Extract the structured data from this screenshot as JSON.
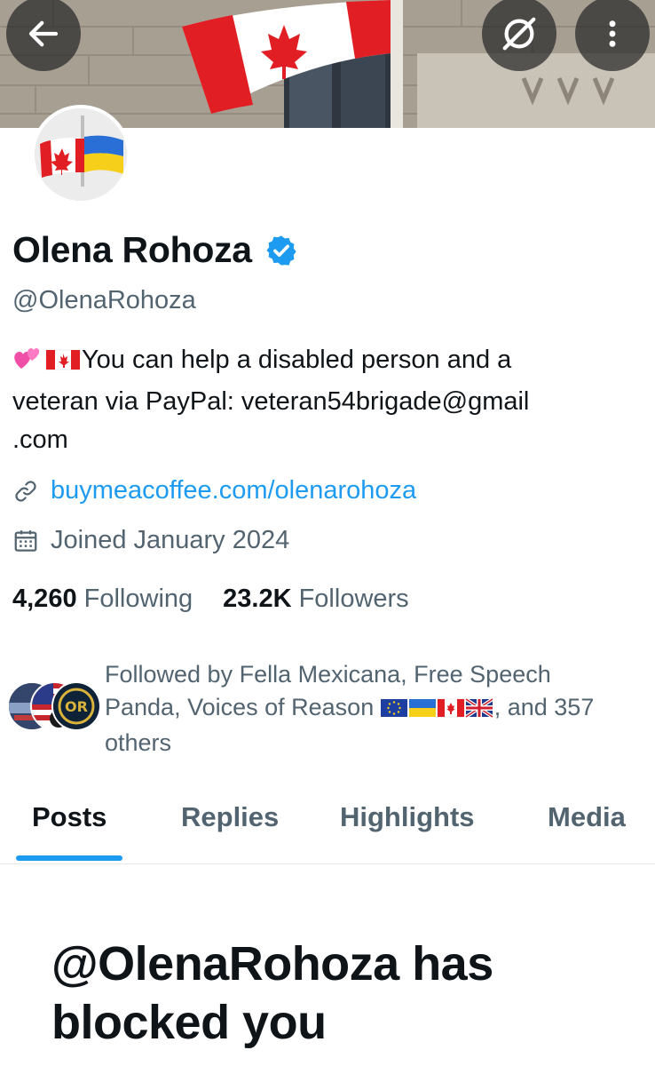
{
  "header": {
    "back_icon": "arrow-left-icon",
    "grok_icon": "grok-icon",
    "more_icon": "more-vertical-icon"
  },
  "profile": {
    "display_name": "Olena Rohoza",
    "verified_icon": "verified-badge-icon",
    "handle": "@OlenaRohoza",
    "bio_emojis": "💕🇨🇦",
    "bio_line1": "You can help a disabled person and a",
    "bio_line2": "veteran via PayPal: veteran54brigade@gmail",
    "bio_line3": ".com",
    "link": "buymeacoffee.com/olenarohoza",
    "joined": "Joined January 2024",
    "following_count": "4,260",
    "following_label": "Following",
    "followers_count": "23.2K",
    "followers_label": "Followers"
  },
  "followed_by": {
    "line1": "Followed by Fella Mexicana, Free Speech",
    "line2_a": "Panda, Voices of Reason",
    "line2_flags": "🇪🇺🇺🇦🇨🇦🇬🇧",
    "line2_b": ", and 357",
    "line3": "others"
  },
  "tabs": [
    "Posts",
    "Replies",
    "Highlights",
    "Media"
  ],
  "active_tab": "Posts",
  "blocked_message_line1": "@OlenaRohoza has",
  "blocked_message_line2": "blocked you",
  "colors": {
    "accent": "#1d9bf0",
    "text_primary": "#0f1419",
    "text_secondary": "#536471"
  }
}
